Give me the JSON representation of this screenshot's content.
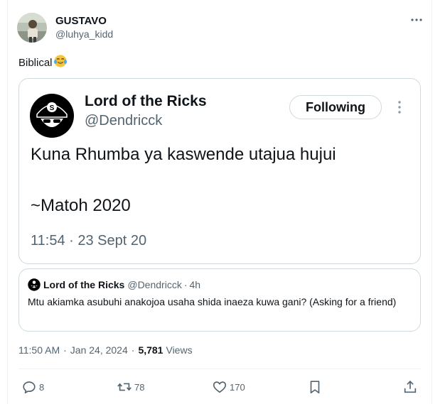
{
  "author": {
    "name": "GUSTAVO",
    "handle": "@luhya_kidd"
  },
  "tweet": {
    "text": "Biblical",
    "emoji": "😂"
  },
  "image": {
    "name": "Lord of the Ricks",
    "handle": "@Dendricck",
    "follow_label": "Following",
    "text_line1": "Kuna Rhumba ya kaswende utajua hujui",
    "text_line2": "~Matoh 2020",
    "timestamp": "11:54 · 23 Sept 20"
  },
  "quote": {
    "name": "Lord of the Ricks",
    "handle": "@Dendricck",
    "separator": "·",
    "time": "4h",
    "text": "Mtu akiamka asubuhi anakojoa usaha shida inaeza kuwa gani? (Asking for a friend)"
  },
  "meta": {
    "time": "11:50 AM",
    "date": "Jan 24, 2024",
    "separator": "·",
    "views_count": "5,781",
    "views_label": "Views"
  },
  "actions": {
    "reply_count": "8",
    "retweet_count": "78",
    "like_count": "170"
  },
  "icons": {
    "more": "more-horizontal-icon",
    "reply": "reply-icon",
    "retweet": "retweet-icon",
    "like": "heart-icon",
    "bookmark": "bookmark-icon",
    "share": "share-icon"
  },
  "colors": {
    "text_primary": "#0f1419",
    "text_secondary": "#536471",
    "border": "#cfd9de"
  }
}
